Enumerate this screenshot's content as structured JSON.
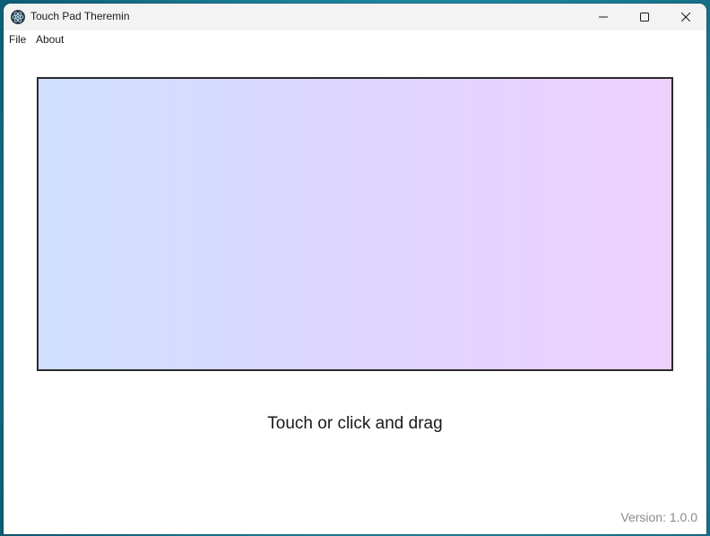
{
  "window": {
    "title": "Touch Pad Theremin",
    "controls": {
      "minimize_icon": "minimize-icon",
      "maximize_icon": "maximize-icon",
      "close_icon": "close-icon"
    }
  },
  "menubar": {
    "items": [
      {
        "label": "File"
      },
      {
        "label": "About"
      }
    ]
  },
  "pad": {
    "gradient_start_color": "#cfe0ff",
    "gradient_end_color": "#eed0ff",
    "border_color": "#2b2b2b"
  },
  "instruction": "Touch or click and drag",
  "version_text": "Version: 1.0.0",
  "colors": {
    "desktop_accent": "#1f8aa3",
    "window_background": "#ffffff",
    "titlebar_background": "#f3f3f3",
    "version_text_color": "#8a8a8a"
  }
}
